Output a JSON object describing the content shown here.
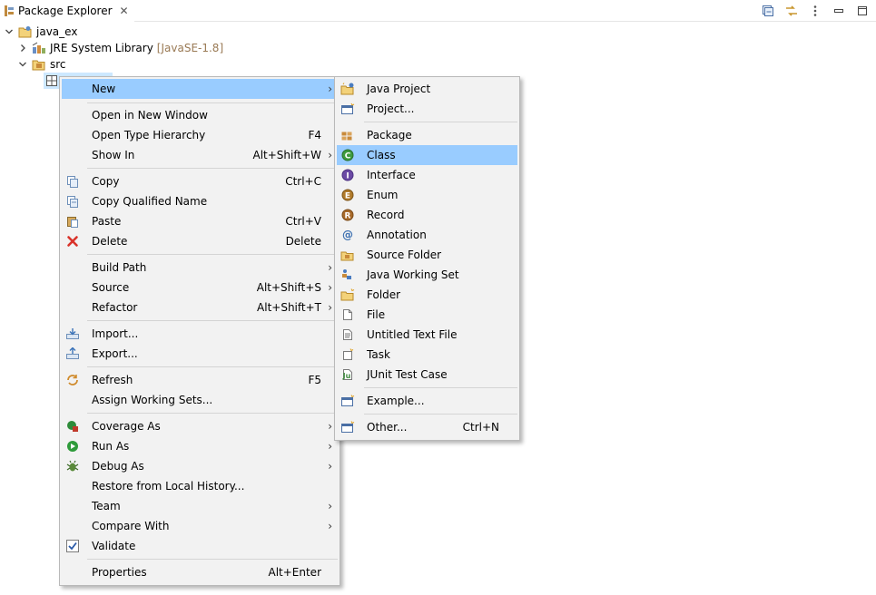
{
  "view": {
    "title": "Package Explorer",
    "close": "✕"
  },
  "tree": {
    "project": "java_ex",
    "library": "JRE System Library",
    "library_suffix": "[JavaSE-1.8]",
    "src": "src"
  },
  "context_menu": {
    "items": [
      {
        "label": "New",
        "shortcut": "",
        "submenu": true
      },
      {
        "label": "Open in New Window",
        "shortcut": ""
      },
      {
        "label": "Open Type Hierarchy",
        "shortcut": "F4"
      },
      {
        "label": "Show In",
        "shortcut": "Alt+Shift+W",
        "submenu": true
      },
      {
        "label": "Copy",
        "shortcut": "Ctrl+C"
      },
      {
        "label": "Copy Qualified Name",
        "shortcut": ""
      },
      {
        "label": "Paste",
        "shortcut": "Ctrl+V"
      },
      {
        "label": "Delete",
        "shortcut": "Delete"
      },
      {
        "label": "Build Path",
        "shortcut": "",
        "submenu": true
      },
      {
        "label": "Source",
        "shortcut": "Alt+Shift+S",
        "submenu": true
      },
      {
        "label": "Refactor",
        "shortcut": "Alt+Shift+T",
        "submenu": true
      },
      {
        "label": "Import...",
        "shortcut": ""
      },
      {
        "label": "Export...",
        "shortcut": ""
      },
      {
        "label": "Refresh",
        "shortcut": "F5"
      },
      {
        "label": "Assign Working Sets...",
        "shortcut": ""
      },
      {
        "label": "Coverage As",
        "shortcut": "",
        "submenu": true
      },
      {
        "label": "Run As",
        "shortcut": "",
        "submenu": true
      },
      {
        "label": "Debug As",
        "shortcut": "",
        "submenu": true
      },
      {
        "label": "Restore from Local History...",
        "shortcut": ""
      },
      {
        "label": "Team",
        "shortcut": "",
        "submenu": true
      },
      {
        "label": "Compare With",
        "shortcut": "",
        "submenu": true
      },
      {
        "label": "Validate",
        "shortcut": ""
      },
      {
        "label": "Properties",
        "shortcut": "Alt+Enter"
      }
    ],
    "submenu_arrow": "›"
  },
  "new_submenu": {
    "items": [
      {
        "label": "Java Project"
      },
      {
        "label": "Project..."
      },
      {
        "label": "Package"
      },
      {
        "label": "Class"
      },
      {
        "label": "Interface"
      },
      {
        "label": "Enum"
      },
      {
        "label": "Record"
      },
      {
        "label": "Annotation"
      },
      {
        "label": "Source Folder"
      },
      {
        "label": "Java Working Set"
      },
      {
        "label": "Folder"
      },
      {
        "label": "File"
      },
      {
        "label": "Untitled Text File"
      },
      {
        "label": "Task"
      },
      {
        "label": "JUnit Test Case"
      },
      {
        "label": "Example..."
      },
      {
        "label": "Other...",
        "shortcut": "Ctrl+N"
      }
    ]
  },
  "colors": {
    "highlight": "#99ccff",
    "menu_bg": "#f2f2f2",
    "selection": "#cde8ff"
  }
}
